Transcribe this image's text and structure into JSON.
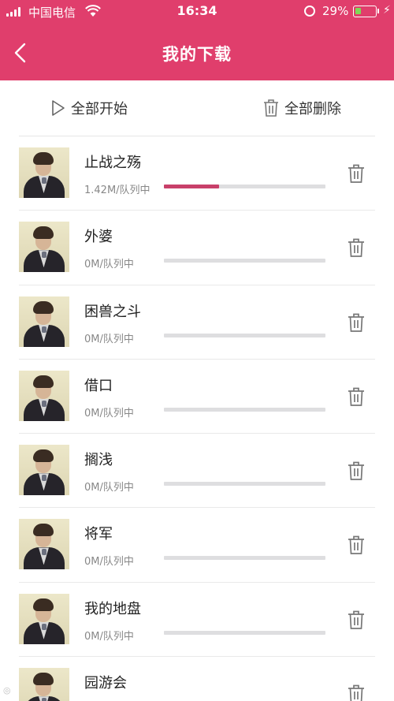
{
  "status_bar": {
    "carrier": "中国电信",
    "time": "16:34",
    "battery_percent": "29%",
    "battery_level": 0.29
  },
  "nav": {
    "title": "我的下载",
    "back_icon": "chevron-left-icon"
  },
  "toolbar": {
    "start_all": "全部开始",
    "delete_all": "全部删除"
  },
  "downloads": [
    {
      "title": "止战之殇",
      "status": "1.42M/队列中",
      "progress": 0.34
    },
    {
      "title": "外婆",
      "status": "0M/队列中",
      "progress": 0
    },
    {
      "title": "困兽之斗",
      "status": "0M/队列中",
      "progress": 0
    },
    {
      "title": "借口",
      "status": "0M/队列中",
      "progress": 0
    },
    {
      "title": "搁浅",
      "status": "0M/队列中",
      "progress": 0
    },
    {
      "title": "将军",
      "status": "0M/队列中",
      "progress": 0
    },
    {
      "title": "我的地盘",
      "status": "0M/队列中",
      "progress": 0
    },
    {
      "title": "园游会",
      "status": "",
      "progress": 0
    }
  ],
  "colors": {
    "accent": "#e03e6c",
    "progress": "#c8406a",
    "progress_track": "#dedee0"
  }
}
